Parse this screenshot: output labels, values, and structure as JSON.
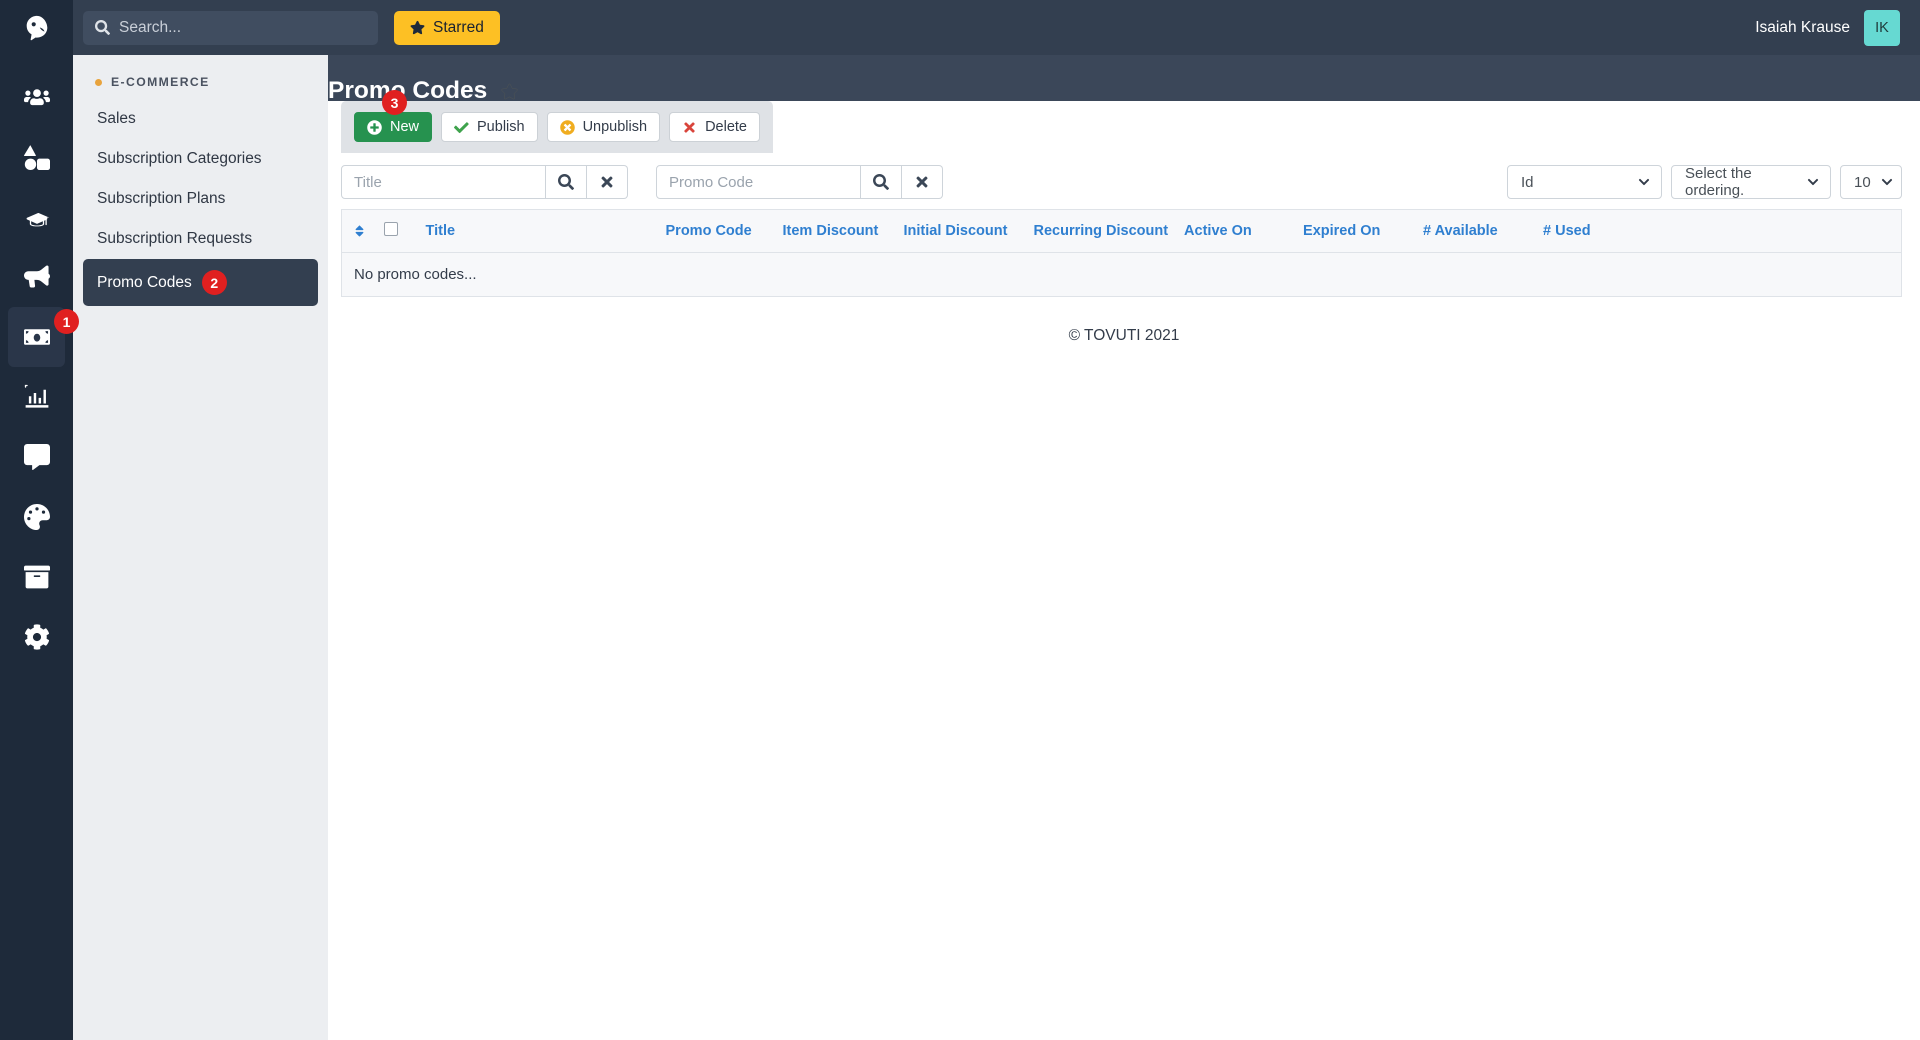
{
  "topbar": {
    "logo_icon": "tovuti-bird-logo",
    "search": {
      "placeholder": "Search...",
      "value": "",
      "icon": "search-icon"
    },
    "starred_label": "Starred",
    "starred_icon": "star-filled-icon",
    "user_name": "Isaiah Krause",
    "avatar_initials": "IK"
  },
  "icon_rail": {
    "items": [
      {
        "name": "users-icon",
        "badge": ""
      },
      {
        "name": "shapes-icon",
        "badge": ""
      },
      {
        "name": "graduation-cap-icon",
        "badge": ""
      },
      {
        "name": "megaphone-icon",
        "badge": ""
      },
      {
        "name": "money-bill-icon",
        "badge": "1",
        "active": true
      },
      {
        "name": "analytics-chart-icon",
        "badge": ""
      },
      {
        "name": "chat-bubble-icon",
        "badge": ""
      },
      {
        "name": "palette-icon",
        "badge": ""
      },
      {
        "name": "archive-box-icon",
        "badge": ""
      },
      {
        "name": "gear-icon",
        "badge": ""
      }
    ]
  },
  "sidebar": {
    "section_label": "E-COMMERCE",
    "items": [
      {
        "label": "Sales",
        "badge": "",
        "active": false
      },
      {
        "label": "Subscription Categories",
        "badge": "",
        "active": false
      },
      {
        "label": "Subscription Plans",
        "badge": "",
        "active": false
      },
      {
        "label": "Subscription Requests",
        "badge": "",
        "active": false
      },
      {
        "label": "Promo Codes",
        "badge": "2",
        "active": true
      }
    ]
  },
  "page": {
    "title": "Promo Codes",
    "star_icon": "star-outline-icon"
  },
  "toolbar": {
    "badge": "3",
    "new_label": "New",
    "publish_label": "Publish",
    "unpublish_label": "Unpublish",
    "delete_label": "Delete"
  },
  "filters": {
    "title_placeholder": "Title",
    "title_value": "",
    "promo_placeholder": "Promo Code",
    "promo_value": "",
    "search_icon": "search-icon",
    "clear_icon": "times-clear-icon",
    "sort_field": "Id",
    "ordering": "Select the ordering.",
    "page_size": "10"
  },
  "table": {
    "columns": [
      "Title",
      "Promo Code",
      "Item Discount",
      "Initial Discount",
      "Recurring Discount",
      "Active On",
      "Expired On",
      "# Available",
      "# Used"
    ],
    "empty_message": "No promo codes...",
    "rows": []
  },
  "footer": {
    "copyright": "© TOVUTI 2021"
  },
  "colors": {
    "rail_bg": "#1e2a3a",
    "topbar_bg": "#333f50",
    "accent_yellow": "#fdc024",
    "badge_red": "#e02020",
    "primary_green": "#26924f",
    "link_blue": "#2f7fd0",
    "avatar_teal": "#66d9d2"
  }
}
